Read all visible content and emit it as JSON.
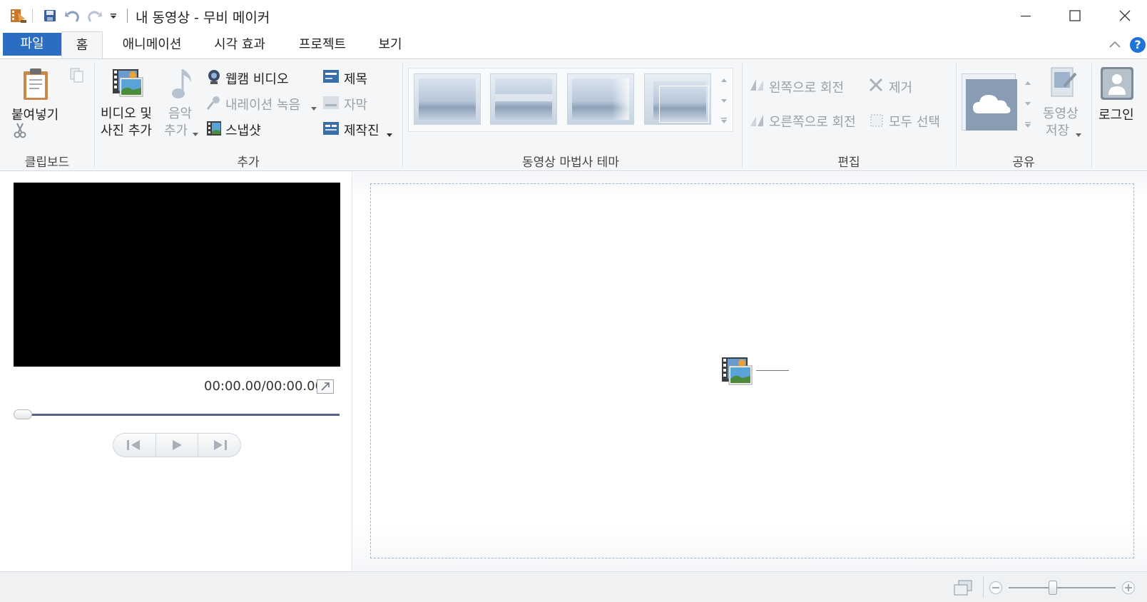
{
  "window": {
    "title": "내 동영상 - 무비 메이커"
  },
  "tabs": [
    {
      "label": "파일"
    },
    {
      "label": "홈"
    },
    {
      "label": "애니메이션"
    },
    {
      "label": "시각 효과"
    },
    {
      "label": "프로젝트"
    },
    {
      "label": "보기"
    }
  ],
  "ribbon": {
    "clipboard": {
      "paste_label": "붙여넣기",
      "group_label": "클립보드"
    },
    "add": {
      "add_videos_line1": "비디오 및",
      "add_videos_line2": "사진 추가",
      "music_line1": "음악",
      "music_line2": "추가",
      "webcam": "웹캠 비디오",
      "narration": "내레이션 녹음",
      "snapshot": "스냅샷",
      "title": "제목",
      "caption": "자막",
      "credits": "제작진",
      "group_label": "추가"
    },
    "themes": {
      "group_label": "동영상 마법사 테마"
    },
    "editing": {
      "rotate_left": "왼쪽으로 회전",
      "rotate_right": "오른쪽으로 회전",
      "remove": "제거",
      "select_all": "모두 선택",
      "group_label": "편집"
    },
    "share": {
      "save_movie_line1": "동영상",
      "save_movie_line2": "저장",
      "group_label": "공유"
    },
    "account": {
      "sign_in": "로그인"
    }
  },
  "player": {
    "timecode": "00:00.00/00:00.00",
    "position": 0
  },
  "colors": {
    "accent": "#2b6dc2",
    "help": "#1e73d8"
  }
}
